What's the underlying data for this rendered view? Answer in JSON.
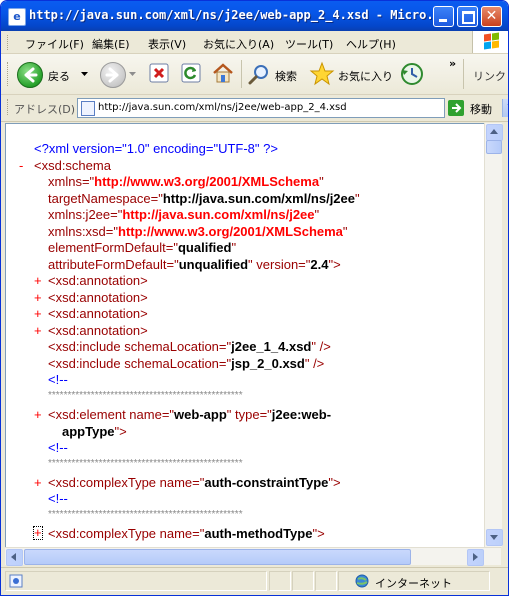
{
  "window": {
    "title": "http://java.sun.com/xml/ns/j2ee/web-app_2_4.xsd - Micro...",
    "close_symbol": "✕"
  },
  "menu": {
    "items": [
      {
        "label": "ファイル(F)"
      },
      {
        "label": "編集(E)"
      },
      {
        "label": "表示(V)"
      },
      {
        "label": "お気に入り(A)"
      },
      {
        "label": "ツール(T)"
      },
      {
        "label": "ヘルプ(H)"
      }
    ]
  },
  "toolbar": {
    "back_label": "戻る",
    "search_label": "検索",
    "favorites_label": "お気に入り",
    "chevron": "»",
    "links_label": "リンク"
  },
  "address": {
    "label": "アドレス(D)",
    "url": "http://java.sun.com/xml/ns/j2ee/web-app_2_4.xsd",
    "go_label": "移動"
  },
  "xml": {
    "decl_open": "<?xml",
    "decl_version": "version=\"1.0\"",
    "decl_encoding": "encoding=\"UTF-8\"",
    "decl_close": "?>",
    "root_marker": "-",
    "root_tag": "<xsd:schema",
    "a1_name": "xmlns=\"",
    "a1_value": "http://www.w3.org/2001/XMLSchema",
    "a1_end": "\"",
    "a2_name": "targetNamespace=\"",
    "a2_value": "http://java.sun.com/xml/ns/j2ee",
    "a2_end": "\"",
    "a3_name": "xmlns:j2ee=\"",
    "a3_value": "http://java.sun.com/xml/ns/j2ee",
    "a3_end": "\"",
    "a4_name": "xmlns:xsd=\"",
    "a4_value": "http://www.w3.org/2001/XMLSchema",
    "a4_end": "\"",
    "a5_name": "elementFormDefault=\"",
    "a5_value": "qualified",
    "a5_end": "\"",
    "a6_name": "attributeFormDefault=\"",
    "a6_value": "unqualified",
    "a6_mid": "\" version=\"",
    "a6_value2": "2.4",
    "a6_end": "\">",
    "plus": "+",
    "annotation": "<xsd:annotation>",
    "include_open": "<xsd:include schemaLocation=\"",
    "include1_value": "j2ee_1_4.xsd",
    "include2_value": "jsp_2_0.xsd",
    "include_close": "\" />",
    "comment_open": "<!--",
    "stars": "**************************************************",
    "el_open": "<xsd:element name=\"",
    "el_name": "web-app",
    "el_mid": "\" type=\"",
    "el_type1": "j2ee:web-",
    "el_type2": "appType",
    "el_close": "\">",
    "ct_open": "<xsd:complexType name=\"",
    "ct1_name": "auth-constraintType",
    "ct2_name": "auth-methodType",
    "ct_close": "\">"
  },
  "status": {
    "zone": "インターネット"
  },
  "colors": {
    "title_bar": "#0a5cf0",
    "xml_tag": "#990000",
    "xml_markup": "#0000ff",
    "xml_value_ns": "#ff0000",
    "xml_value": "#000000",
    "xml_comment": "#888888"
  }
}
